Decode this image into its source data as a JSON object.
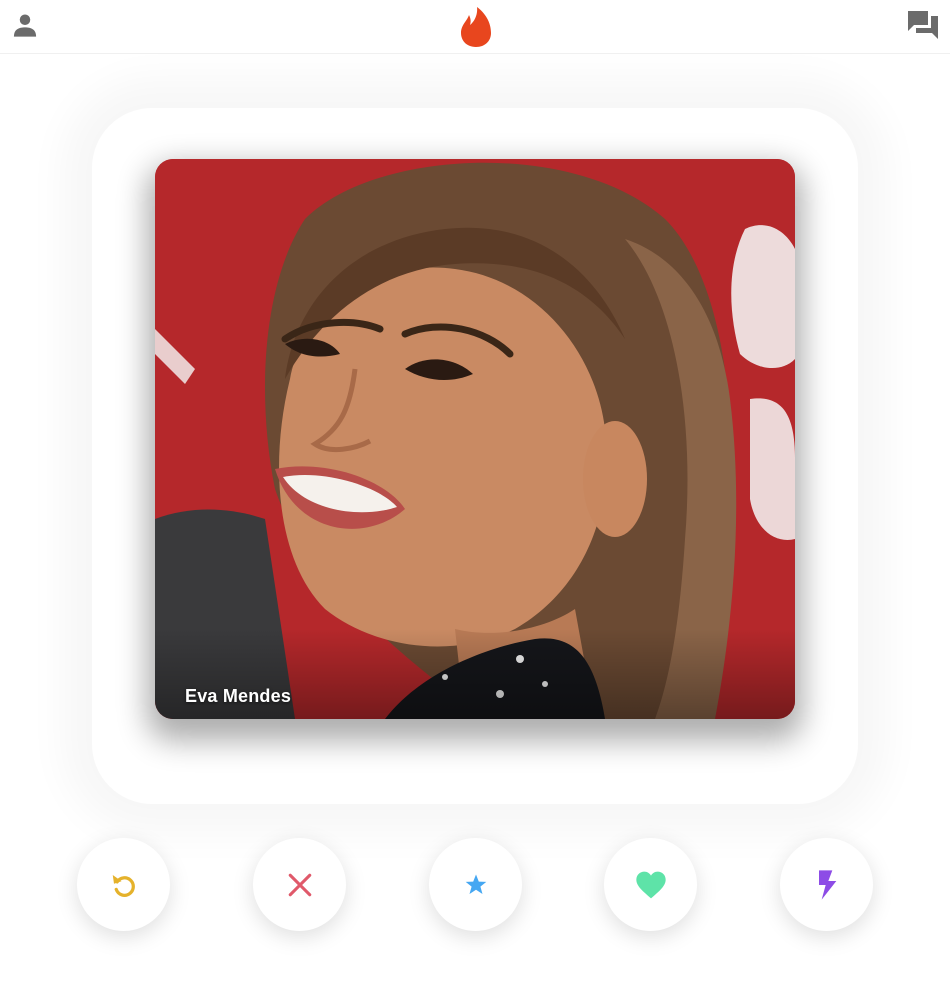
{
  "header": {
    "left_icon": "person-icon",
    "center_icon": "flame-logo-icon",
    "right_icon": "chat-bubbles-icon",
    "colors": {
      "icon": "#6b6b6b",
      "flame": "#e8461e"
    }
  },
  "card": {
    "name": "Eva Mendes",
    "photo_description_icon": "profile-photo"
  },
  "actions": [
    {
      "name": "rewind",
      "icon": "rewind-icon",
      "color": "#e5b22b"
    },
    {
      "name": "nope",
      "icon": "close-icon",
      "color": "#e0596a"
    },
    {
      "name": "super-like",
      "icon": "star-icon",
      "color": "#45a7f2"
    },
    {
      "name": "like",
      "icon": "heart-icon",
      "color": "#5ee3a8"
    },
    {
      "name": "boost",
      "icon": "lightning-icon",
      "color": "#8d4ce6"
    }
  ]
}
